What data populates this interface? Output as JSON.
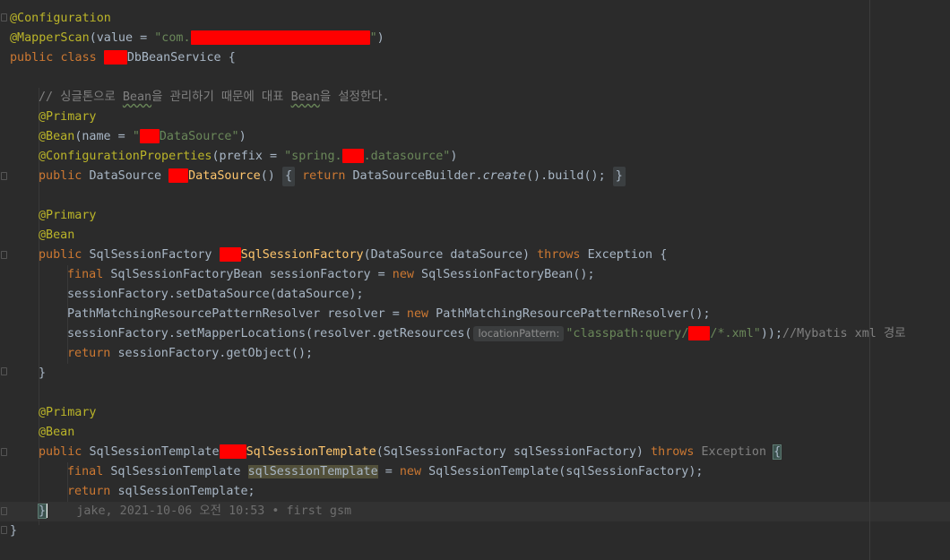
{
  "code": {
    "l1_annotation": "@Configuration",
    "l2_annotation": "@MapperScan",
    "l2_args_open": "(value = ",
    "l2_str_prefix": "\"com.",
    "l2_str_suffix": "\"",
    "l2_close": ")",
    "l3_public": "public",
    "l3_class": "class",
    "l3_name_suffix": "DbBeanService",
    "l3_brace": "{",
    "l5_comment_a": "// 싱글톤으로 ",
    "l5_comment_bean1": "Bean",
    "l5_comment_b": "을 관리하기 때문에 대표 ",
    "l5_comment_bean2": "Bean",
    "l5_comment_c": "을 설정한다.",
    "l6_primary": "@Primary",
    "l7_bean": "@Bean",
    "l7_args_open": "(name = ",
    "l7_str_open": "\"",
    "l7_str_rest": "DataSource\"",
    "l7_close": ")",
    "l8_annotation": "@ConfigurationProperties",
    "l8_args_open": "(prefix = ",
    "l8_str_a": "\"spring.",
    "l8_str_b": ".datasource\"",
    "l8_close": ")",
    "l9_public": "public",
    "l9_type": "DataSource",
    "l9_method_suffix": "DataSource",
    "l9_parens": "()",
    "l9_fold_open": "{",
    "l9_return": "return",
    "l9_builder": "DataSourceBuilder.",
    "l9_create": "create",
    "l9_build": "().build();",
    "l9_fold_close": "}",
    "l11_primary": "@Primary",
    "l12_bean": "@Bean",
    "l13_public": "public",
    "l13_type": "SqlSessionFactory",
    "l13_method_suffix": "SqlSessionFactory",
    "l13_params": "(DataSource dataSource)",
    "l13_throws": "throws",
    "l13_exception": "Exception",
    "l13_brace": "{",
    "l14_final": "final",
    "l14_rest": "SqlSessionFactoryBean sessionFactory = ",
    "l14_new": "new",
    "l14_ctor": "SqlSessionFactoryBean();",
    "l15_text": "sessionFactory.setDataSource(dataSource);",
    "l16_rest": "PathMatchingResourcePatternResolver resolver = ",
    "l16_new": "new",
    "l16_ctor": "PathMatchingResourcePatternResolver();",
    "l17_call": "sessionFactory.setMapperLocations(resolver.getResources(",
    "l17_hint": "locationPattern:",
    "l17_str_a": "\"classpath:query/",
    "l17_str_b": "/*.xml\"",
    "l17_close": "));",
    "l17_comment": "//Mybatis xml 경로",
    "l18_return": "return",
    "l18_rest": "sessionFactory.getObject();",
    "l19_brace": "}",
    "l21_primary": "@Primary",
    "l22_bean": "@Bean",
    "l23_public": "public",
    "l23_type": "SqlSessionTemplate",
    "l23_method_suffix": "SqlSessionTemplate",
    "l23_params": "(SqlSessionFactory sqlSessionFactory)",
    "l23_throws": "throws",
    "l23_exception": "Exception",
    "l23_brace": "{",
    "l24_final": "final",
    "l24_type": "SqlSessionTemplate",
    "l24_var": "sqlSessionTemplate",
    "l24_assign": " = ",
    "l24_new": "new",
    "l24_ctor": "SqlSessionTemplate(sqlSessionFactory);",
    "l25_return": "return",
    "l25_rest": "sqlSessionTemplate;",
    "l26_brace": "}",
    "l26_blame": "jake, 2021-10-06 오전 10:53 • first gsm",
    "l27_brace": "}"
  },
  "colors": {
    "background": "#2b2b2b",
    "annotation": "#bbb529",
    "keyword": "#cc7832",
    "string": "#6a8759",
    "comment": "#808080",
    "method": "#ffc66d",
    "plain": "#a9b7c6",
    "redaction": "#ff0000"
  }
}
